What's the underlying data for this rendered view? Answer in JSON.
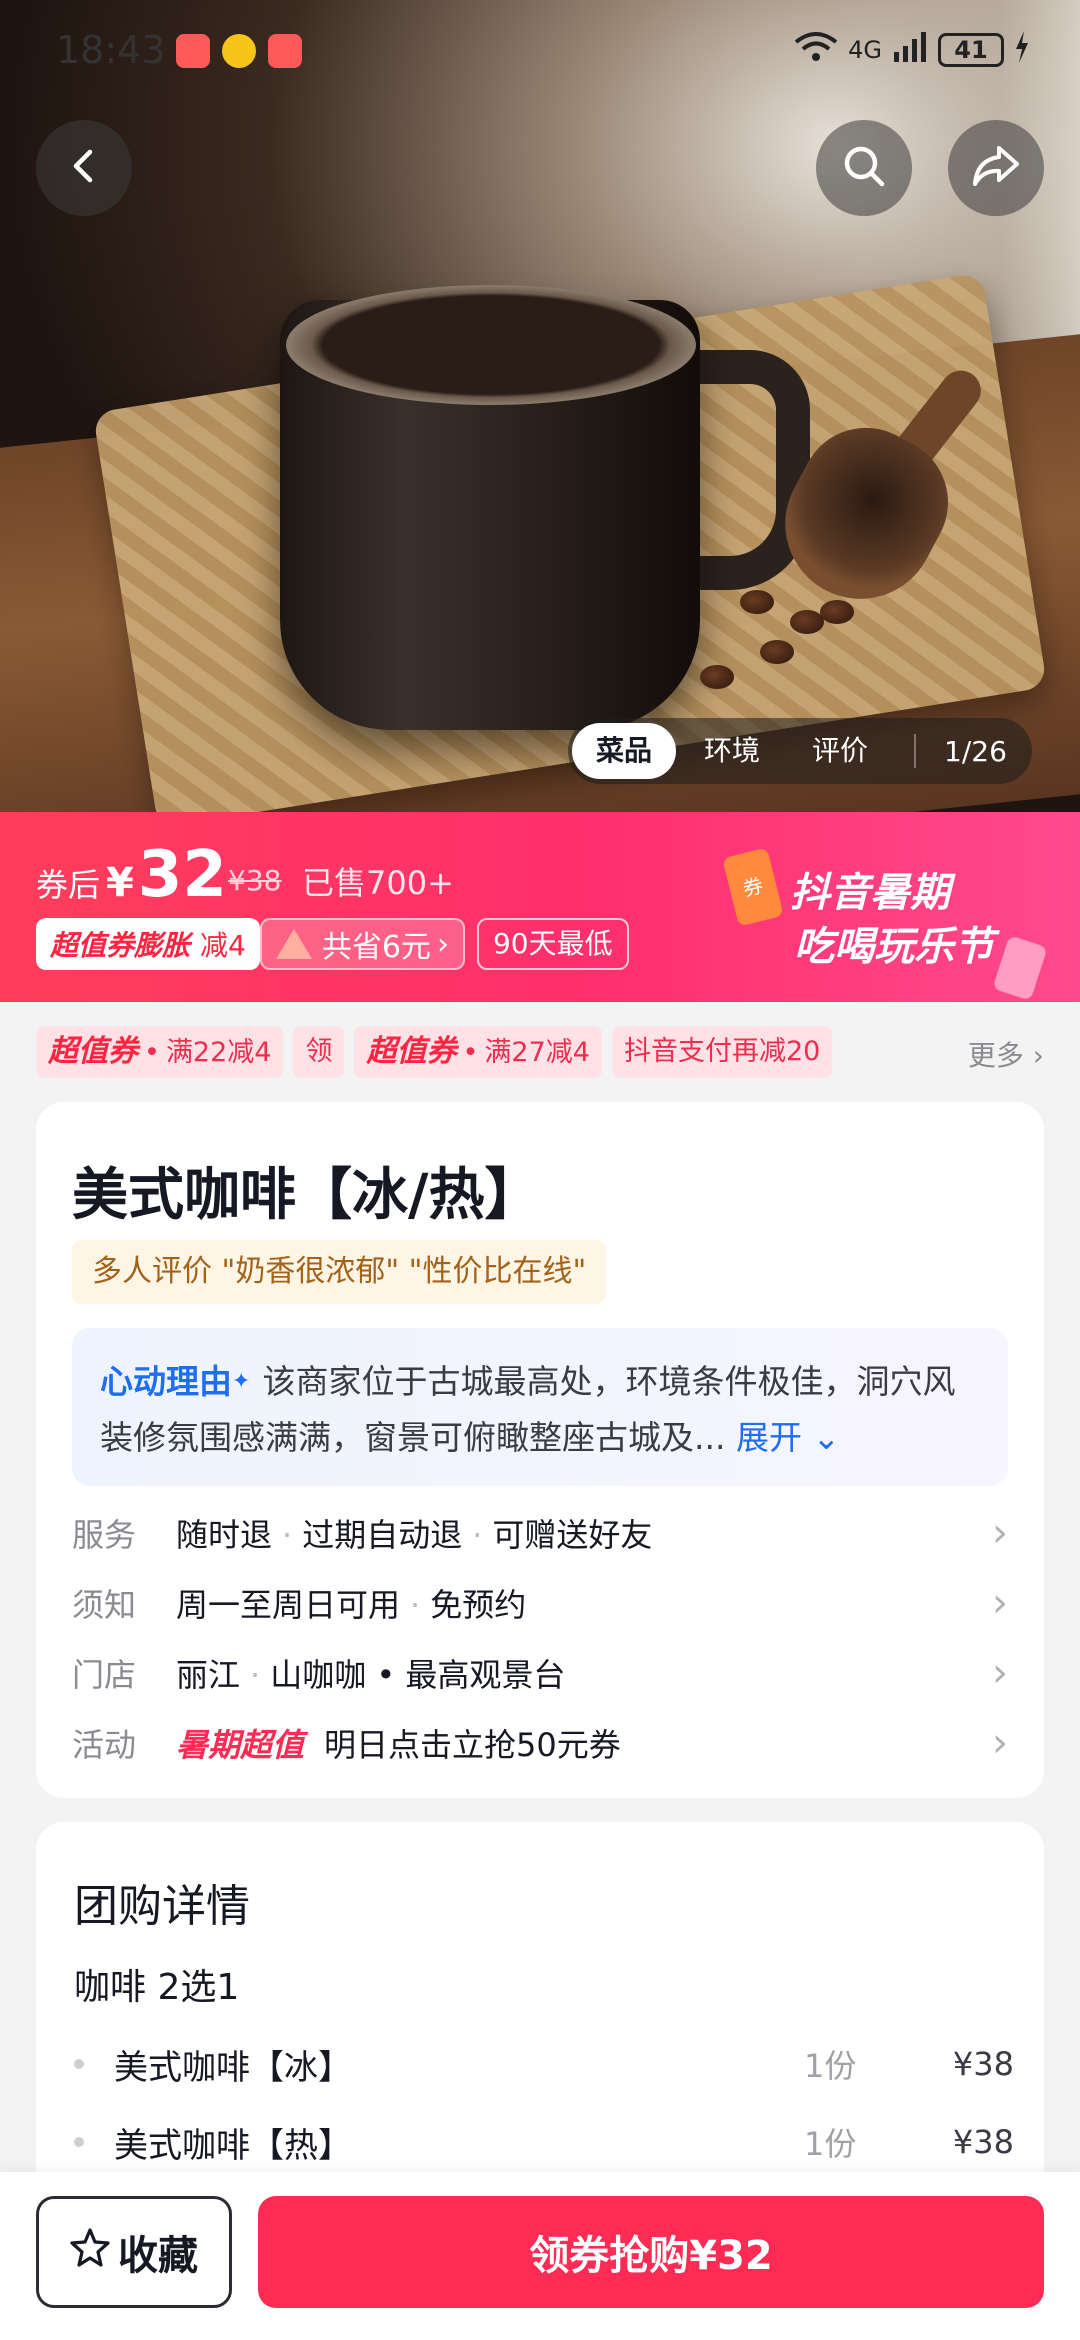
{
  "status_bar": {
    "time": "18:43",
    "network": "4G",
    "battery": "41"
  },
  "hero": {
    "tabs": [
      "菜品",
      "环境",
      "评价"
    ],
    "active_tab": 0,
    "counter": "1/26"
  },
  "promo": {
    "after_label": "券后",
    "currency": "¥",
    "price": "32",
    "original_price": "¥38",
    "sold": "已售700+",
    "coupon_brand": "超值券膨胀",
    "coupon_minus": "减4",
    "saved": "共省6元",
    "lowest": "90天最低",
    "festival_line1": "抖音暑期",
    "festival_line2": "吃喝玩乐节"
  },
  "coupons": {
    "items": [
      {
        "brand": "超值券",
        "text": "满22减4"
      },
      {
        "text": "领"
      },
      {
        "brand": "超值券",
        "text": "满27减4"
      },
      {
        "text": "抖音支付再减20"
      }
    ],
    "more": "更多"
  },
  "detail": {
    "title": "美式咖啡【冰/热】",
    "review_tag": "多人评价 \"奶香很浓郁\" \"性价比在线\"",
    "reason_label": "心动理由",
    "reason_text": "该商家位于古城最高处，环境条件极佳，洞穴风装修氛围感满满，窗景可俯瞰整座古城及...",
    "reason_expand": "展开",
    "rows": [
      {
        "key": "服务",
        "values": [
          "随时退",
          "过期自动退",
          "可赠送好友"
        ]
      },
      {
        "key": "须知",
        "values": [
          "周一至周日可用",
          "免预约"
        ]
      },
      {
        "key": "门店",
        "values": [
          "丽江",
          "山咖咖 • 最高观景台"
        ]
      },
      {
        "key": "活动",
        "hot": "暑期超值",
        "values": [
          "明日点击立抢50元券"
        ]
      }
    ]
  },
  "group": {
    "title": "团购详情",
    "subtitle": "咖啡 2选1",
    "items": [
      {
        "name": "美式咖啡【冰】",
        "qty": "1份",
        "price": "¥38"
      },
      {
        "name": "美式咖啡【热】",
        "qty": "1份",
        "price": "¥38"
      }
    ]
  },
  "bottom": {
    "favorite": "收藏",
    "buy": "领券抢购¥32"
  },
  "colors": {
    "accent": "#fe2c55",
    "reason_blue": "#1f6df3"
  }
}
